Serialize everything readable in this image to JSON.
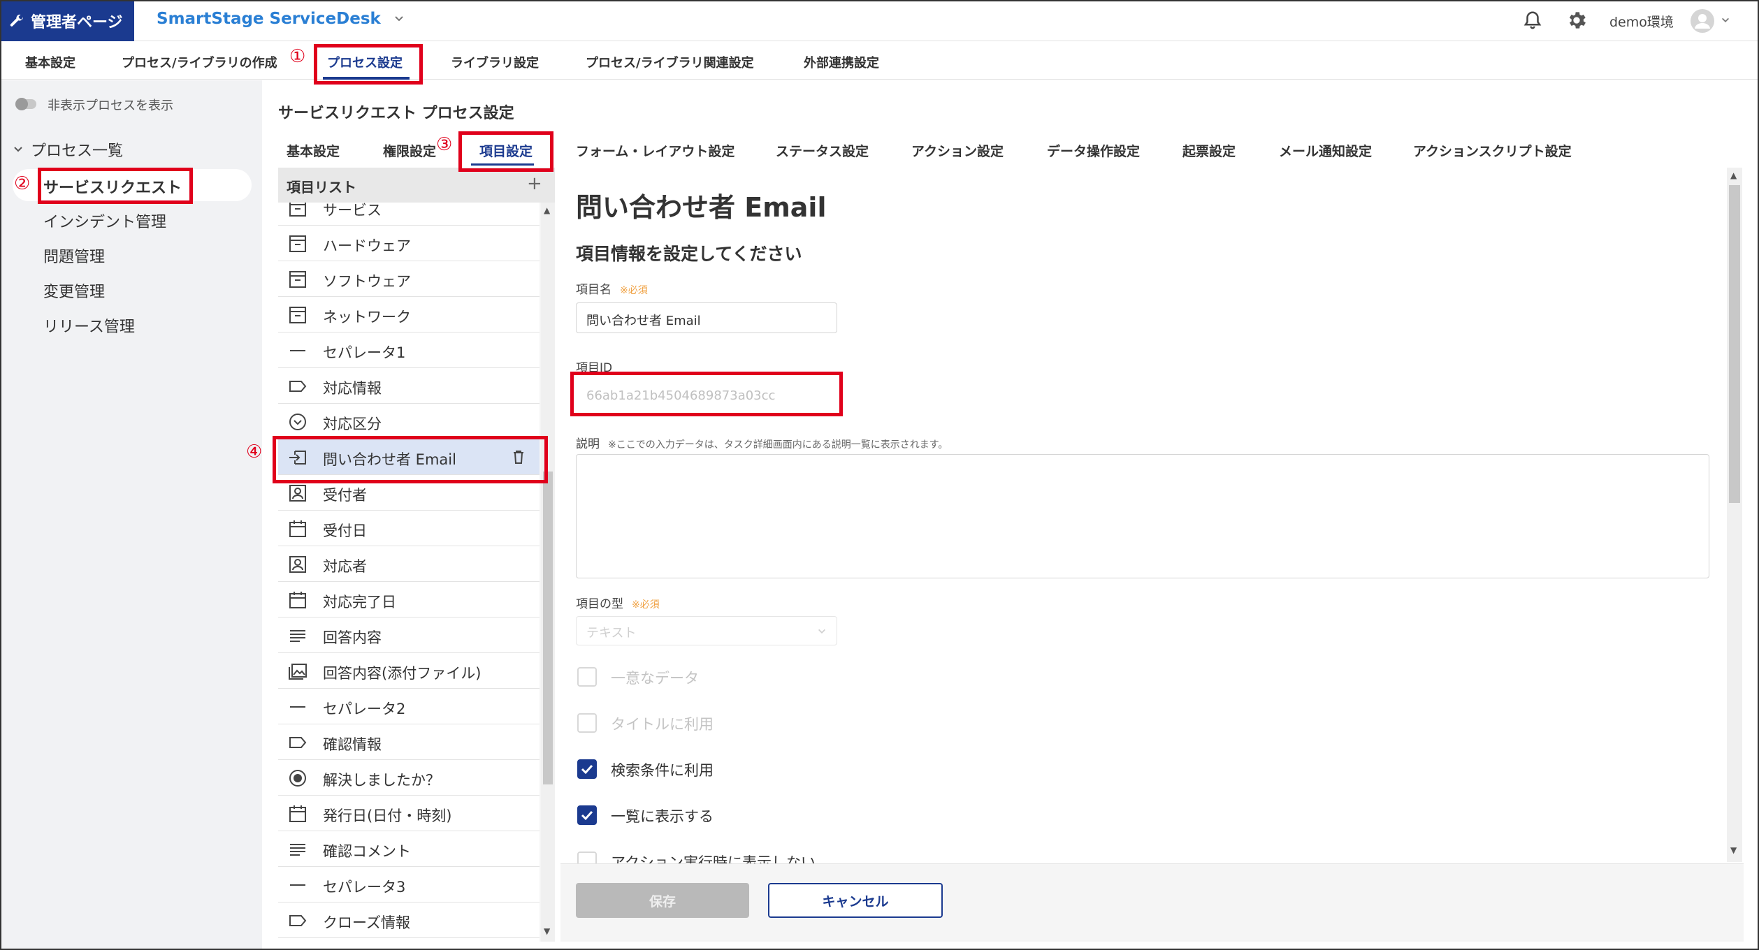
{
  "header": {
    "admin_label": "管理者ページ",
    "app_title": "SmartStage ServiceDesk",
    "env_label": "demo環境"
  },
  "mainnav": {
    "items": [
      "基本設定",
      "プロセス/ライブラリの作成",
      "プロセス設定",
      "ライブラリ設定",
      "プロセス/ライブラリ関連設定",
      "外部連携設定"
    ],
    "active": "プロセス設定"
  },
  "sidebar": {
    "toggle_label": "非表示プロセスを表示",
    "section_title": "プロセス一覧",
    "processes": [
      "サービスリクエスト",
      "インシデント管理",
      "問題管理",
      "変更管理",
      "リリース管理"
    ],
    "selected": "サービスリクエスト"
  },
  "content": {
    "title": "サービスリクエスト プロセス設定",
    "subtabs": [
      "基本設定",
      "権限設定",
      "項目設定",
      "フォーム・レイアウト設定",
      "ステータス設定",
      "アクション設定",
      "データ操作設定",
      "起票設定",
      "メール通知設定",
      "アクションスクリプト設定"
    ],
    "active_subtab": "項目設定"
  },
  "item_list": {
    "title": "項目リスト",
    "add": "+",
    "items": [
      {
        "label": "サービス",
        "icon": "select-box-icon"
      },
      {
        "label": "ハードウェア",
        "icon": "select-box-icon"
      },
      {
        "label": "ソフトウェア",
        "icon": "select-box-icon"
      },
      {
        "label": "ネットワーク",
        "icon": "select-box-icon"
      },
      {
        "label": "セパレータ1",
        "icon": "separator-icon"
      },
      {
        "label": "対応情報",
        "icon": "label-tag-icon"
      },
      {
        "label": "対応区分",
        "icon": "dropdown-circle-icon"
      },
      {
        "label": "問い合わせ者 Email",
        "icon": "input-arrow-icon"
      },
      {
        "label": "受付者",
        "icon": "user-box-icon"
      },
      {
        "label": "受付日",
        "icon": "calendar-icon"
      },
      {
        "label": "対応者",
        "icon": "user-box-icon"
      },
      {
        "label": "対応完了日",
        "icon": "calendar-icon"
      },
      {
        "label": "回答内容",
        "icon": "lines-icon"
      },
      {
        "label": "回答内容(添付ファイル)",
        "icon": "image-attach-icon"
      },
      {
        "label": "セパレータ2",
        "icon": "separator-icon"
      },
      {
        "label": "確認情報",
        "icon": "label-tag-icon"
      },
      {
        "label": "解決しましたか？",
        "icon": "radio-icon"
      },
      {
        "label": "発行日(日付・時刻)",
        "icon": "calendar-icon"
      },
      {
        "label": "確認コメント",
        "icon": "lines-icon"
      },
      {
        "label": "セパレータ3",
        "icon": "separator-icon"
      },
      {
        "label": "クローズ情報",
        "icon": "label-tag-icon"
      }
    ],
    "selected": "問い合わせ者 Email"
  },
  "form": {
    "title": "問い合わせ者 Email",
    "subtitle": "項目情報を設定してください",
    "name_label": "項目名",
    "required": "※必須",
    "name_value": "問い合わせ者 Email",
    "id_label": "項目ID",
    "id_value": "66ab1a21b4504689873a03cc",
    "desc_label": "説明",
    "desc_note": "※ここでの入力データは、タスク詳細画面内にある説明一覧に表示されます。",
    "type_label": "項目の型",
    "type_value": "テキスト",
    "checkboxes": [
      {
        "label": "一意なデータ",
        "checked": false,
        "disabled": true
      },
      {
        "label": "タイトルに利用",
        "checked": false,
        "disabled": true
      },
      {
        "label": "検索条件に利用",
        "checked": true,
        "disabled": false
      },
      {
        "label": "一覧に表示する",
        "checked": true,
        "disabled": false
      },
      {
        "label": "アクション実行時に表示しない",
        "checked": false,
        "disabled": false
      }
    ],
    "save": "保存",
    "cancel": "キャンセル"
  },
  "annotations": [
    "①",
    "②",
    "③",
    "④"
  ],
  "colors": {
    "brand": "#1b3a8f",
    "link": "#2a7fd4",
    "annotation": "#e0001b",
    "required": "#f0a040"
  }
}
